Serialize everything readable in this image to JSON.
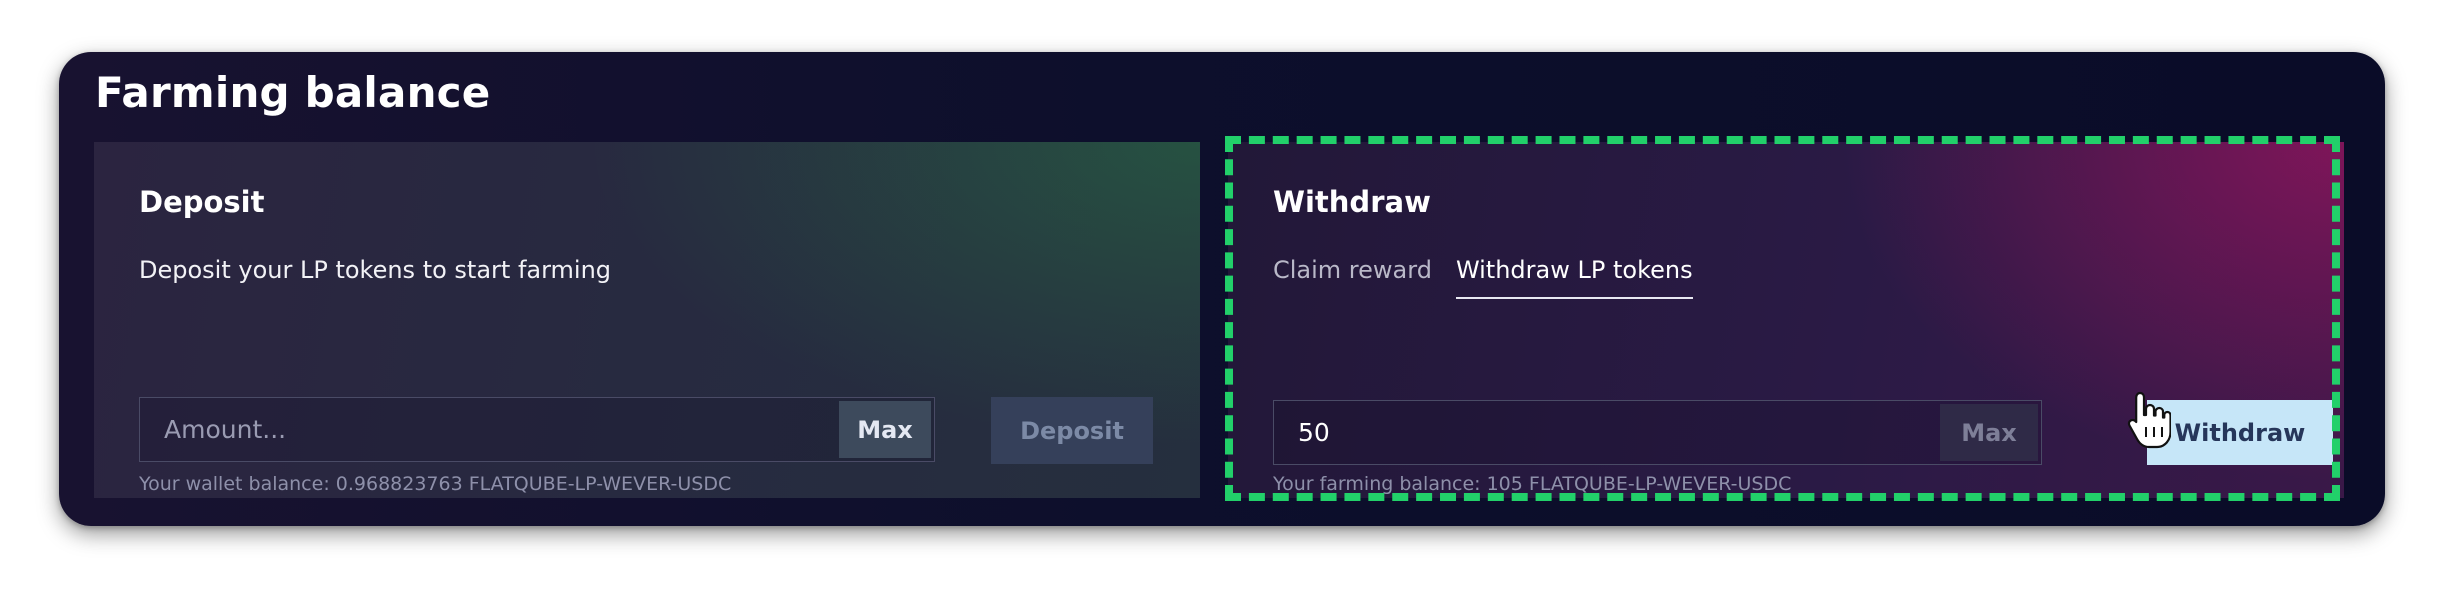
{
  "panel": {
    "title": "Farming balance"
  },
  "deposit": {
    "title": "Deposit",
    "description": "Deposit your LP tokens to start farming",
    "amount_placeholder": "Amount...",
    "amount_value": "",
    "max_label": "Max",
    "button_label": "Deposit",
    "balance_text": "Your wallet balance: 0.968823763 FLATQUBE-LP-WEVER-USDC"
  },
  "withdraw": {
    "title": "Withdraw",
    "tabs": [
      {
        "label": "Claim reward",
        "active": false
      },
      {
        "label": "Withdraw LP tokens",
        "active": true
      }
    ],
    "amount_value": "50",
    "max_label": "Max",
    "button_label": "Withdraw",
    "balance_text": "Your farming balance: 105 FLATQUBE-LP-WEVER-USDC"
  },
  "colors": {
    "highlight": "#22d06a",
    "withdraw_button": "#c6e6f8",
    "panel_background": "#0d0f2c"
  },
  "icons": {
    "cursor": "hand-pointer-icon"
  }
}
